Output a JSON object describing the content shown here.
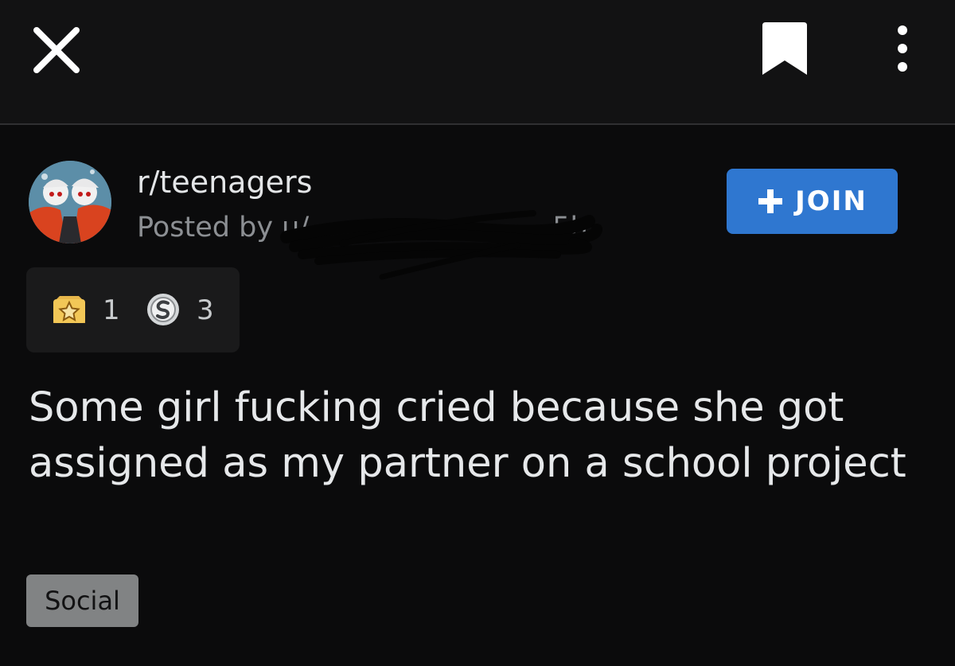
{
  "topbar": {
    "close_icon": "close-icon",
    "bookmark_icon": "bookmark-icon",
    "more_icon": "more-vertical-icon"
  },
  "post": {
    "subreddit": "r/teenagers",
    "posted_by_prefix": "Posted by u/",
    "time_suffix": "· 5h",
    "join_label": "JOIN",
    "join_color": "#2f77d0",
    "awards": [
      {
        "icon": "star-award-icon",
        "count": "1"
      },
      {
        "icon": "silver-award-icon",
        "count": "3"
      }
    ],
    "title": "Some girl fucking cried because she got assigned as my partner on a school project",
    "flair": "Social"
  }
}
